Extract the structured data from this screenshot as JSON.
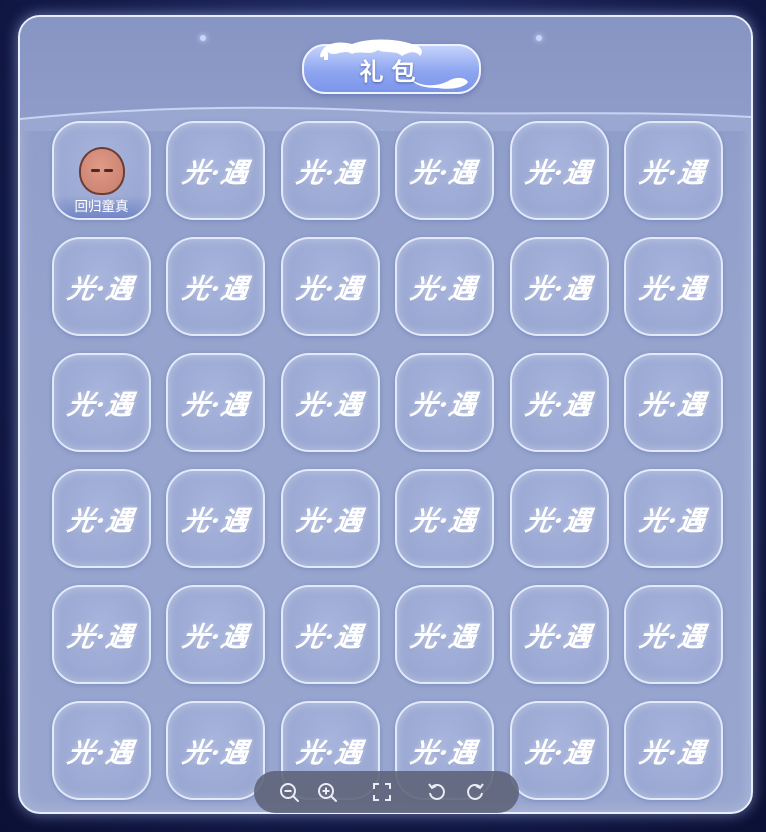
{
  "title": "礼包",
  "placeholder_text": "光·遇",
  "slots": [
    {
      "filled": true,
      "label": "回归童真",
      "icon": "face-mask-icon"
    },
    {
      "filled": false
    },
    {
      "filled": false
    },
    {
      "filled": false
    },
    {
      "filled": false
    },
    {
      "filled": false
    },
    {
      "filled": false
    },
    {
      "filled": false
    },
    {
      "filled": false
    },
    {
      "filled": false
    },
    {
      "filled": false
    },
    {
      "filled": false
    },
    {
      "filled": false
    },
    {
      "filled": false
    },
    {
      "filled": false
    },
    {
      "filled": false
    },
    {
      "filled": false
    },
    {
      "filled": false
    },
    {
      "filled": false
    },
    {
      "filled": false
    },
    {
      "filled": false
    },
    {
      "filled": false
    },
    {
      "filled": false
    },
    {
      "filled": false
    },
    {
      "filled": false
    },
    {
      "filled": false
    },
    {
      "filled": false
    },
    {
      "filled": false
    },
    {
      "filled": false
    },
    {
      "filled": false
    },
    {
      "filled": false
    },
    {
      "filled": false
    },
    {
      "filled": false
    },
    {
      "filled": false
    },
    {
      "filled": false
    },
    {
      "filled": false
    }
  ],
  "toolbar": {
    "buttons": [
      "zoom-out-icon",
      "zoom-in-icon",
      "fullscreen-icon",
      "rotate-left-icon",
      "rotate-right-icon"
    ]
  },
  "colors": {
    "panel": "#95a3cd",
    "badge": "#8ea6f0",
    "background": "#141b4a"
  }
}
